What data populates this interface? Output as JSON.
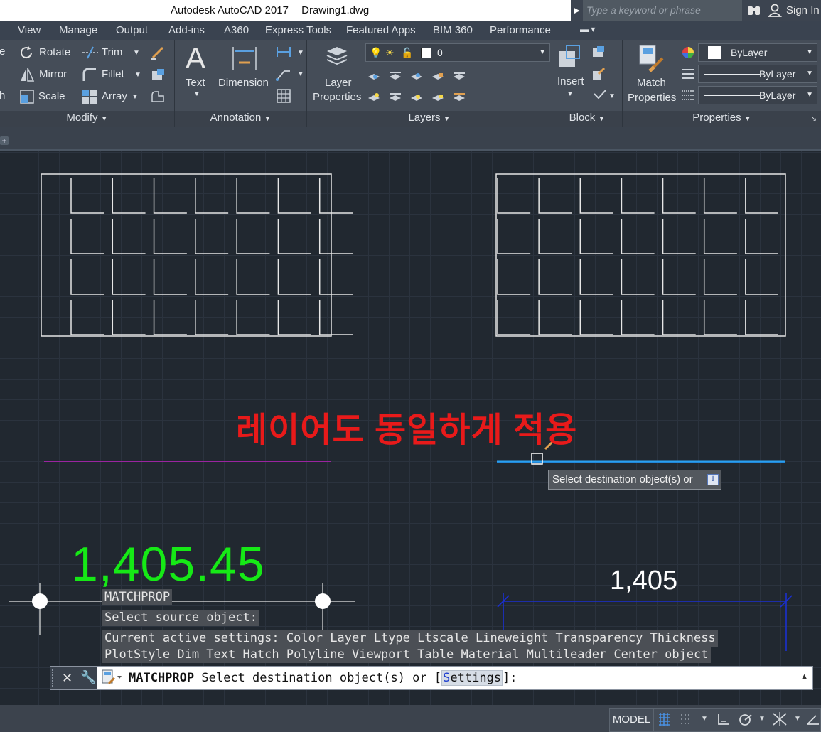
{
  "title_bar": {
    "app_name": "Autodesk AutoCAD 2017",
    "file_name": "Drawing1.dwg",
    "search_placeholder": "Type a keyword or phrase",
    "sign_in": "Sign In"
  },
  "menu_tabs": [
    "View",
    "Manage",
    "Output",
    "Add-ins",
    "A360",
    "Express Tools",
    "Featured Apps",
    "BIM 360",
    "Performance"
  ],
  "ribbon": {
    "modify": {
      "title": "Modify",
      "rotate": "Rotate",
      "mirror": "Mirror",
      "scale": "Scale",
      "trim": "Trim",
      "fillet": "Fillet",
      "array": "Array",
      "stretch_partial": "h",
      "move_partial": "e"
    },
    "annotation": {
      "title": "Annotation",
      "text": "Text",
      "dimension": "Dimension"
    },
    "layers": {
      "title": "Layers",
      "layer_properties_line1": "Layer",
      "layer_properties_line2": "Properties",
      "current_layer": "0"
    },
    "block": {
      "title": "Block",
      "insert": "Insert"
    },
    "properties": {
      "title": "Properties",
      "match_line1": "Match",
      "match_line2": "Properties",
      "color": "ByLayer",
      "linetype": "ByLayer",
      "lineweight": "ByLayer"
    }
  },
  "canvas": {
    "annotation_korean": "레이어도 동일하게 적용",
    "tooltip": "Select destination object(s) or",
    "dimension_large": "1,405.45",
    "dimension_small": "1,405"
  },
  "command_history": [
    "MATCHPROP",
    "Select source object:",
    "Current active settings:  Color Layer Ltype Ltscale Lineweight Transparency Thickness",
    "PlotStyle Dim Text Hatch Polyline Viewport Table Material Multileader Center object"
  ],
  "command_line": {
    "command": "MATCHPROP",
    "prompt": "Select destination object(s) or [",
    "option_hotkey": "S",
    "option_rest": "ettings",
    "prompt_end": "]:"
  },
  "status_bar": {
    "model": "MODEL"
  },
  "colors": {
    "canvas_bg": "#212830",
    "ribbon_bg": "#454d58",
    "korean_text": "#e81a1a",
    "dim_green": "#16e916",
    "magenta_line": "#c020c0",
    "cyan_line": "#2aa0f0",
    "dim_blue": "#1a2fd0"
  },
  "icons": [
    "rotate-icon",
    "mirror-icon",
    "scale-icon",
    "trim-icon",
    "fillet-icon",
    "array-icon",
    "text-icon",
    "dimension-icon",
    "layer-properties-icon",
    "insert-icon",
    "match-properties-icon",
    "binoculars-icon",
    "user-icon",
    "close-icon",
    "wrench-icon",
    "grid-icon",
    "snap-icon",
    "ortho-icon",
    "polar-icon"
  ]
}
